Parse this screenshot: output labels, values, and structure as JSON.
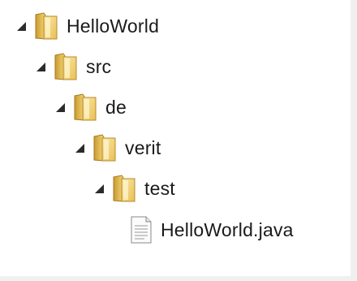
{
  "tree": {
    "root": {
      "label": "HelloWorld",
      "icon": "folder-icon",
      "expanded": true
    },
    "src": {
      "label": "src",
      "icon": "folder-icon",
      "expanded": true
    },
    "de": {
      "label": "de",
      "icon": "folder-icon",
      "expanded": true
    },
    "verit": {
      "label": "verit",
      "icon": "folder-icon",
      "expanded": true
    },
    "test": {
      "label": "test",
      "icon": "folder-icon",
      "expanded": true
    },
    "file": {
      "label": "HelloWorld.java",
      "icon": "java-file-icon"
    }
  }
}
